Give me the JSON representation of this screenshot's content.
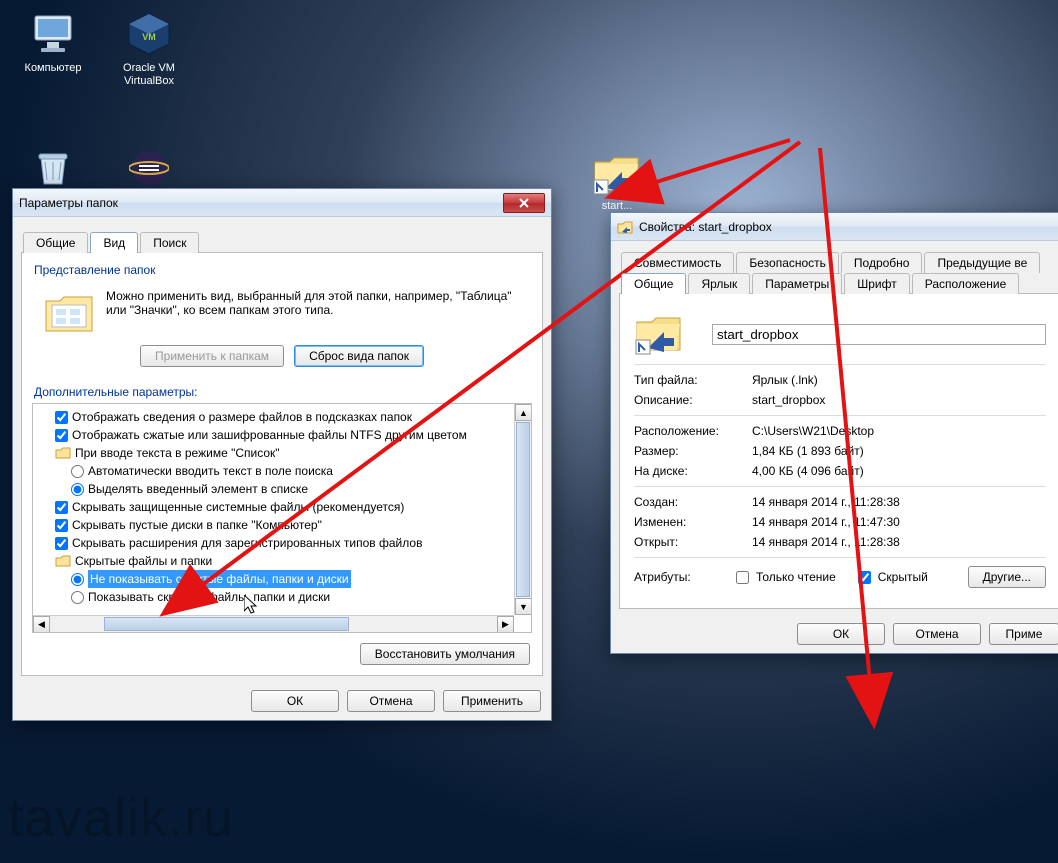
{
  "watermark": "tavalik.ru",
  "desktop": {
    "computer": "Компьютер",
    "virtualbox": "Oracle VM VirtualBox",
    "folder_shortcut_label": "start..."
  },
  "folderOptions": {
    "title": "Параметры папок",
    "tabs": {
      "general": "Общие",
      "view": "Вид",
      "search": "Поиск"
    },
    "group": "Представление папок",
    "desc": "Можно применить вид, выбранный для этой папки, например, \"Таблица\" или \"Значки\", ко всем папкам этого типа.",
    "applyBtn": "Применить к папкам",
    "resetBtn": "Сброс вида папок",
    "advLabel": "Дополнительные параметры:",
    "tree": {
      "size_hint": "Отображать сведения о размере файлов в подсказках папок",
      "ntfs_compressed": "Отображать сжатые или зашифрованные файлы NTFS другим цветом",
      "list_mode": "При вводе текста в режиме \"Список\"",
      "auto_type": "Автоматически вводить текст в поле поиска",
      "select_typed": "Выделять введенный элемент в списке",
      "protected": "Скрывать защищенные системные файлы (рекомендуется)",
      "empty_drives": "Скрывать пустые диски в папке \"Компьютер\"",
      "hide_ext": "Скрывать расширения для зарегистрированных типов файлов",
      "hidden_group": "Скрытые файлы и папки",
      "dont_show": "Не показывать скрытые файлы, папки и диски",
      "show": "Показывать скрытые файлы, папки и диски"
    },
    "restore": "Восстановить умолчания",
    "ok": "ОК",
    "cancel": "Отмена",
    "apply": "Применить"
  },
  "props": {
    "title": "Свойства: start_dropbox",
    "row1": {
      "compat": "Совместимость",
      "security": "Безопасность",
      "details": "Подробно",
      "prev": "Предыдущие ве"
    },
    "row2": {
      "general": "Общие",
      "shortcut": "Ярлык",
      "params": "Параметры",
      "font": "Шрифт",
      "layout": "Расположение"
    },
    "name": "start_dropbox",
    "type_lbl": "Тип файла:",
    "type_val": "Ярлык (.lnk)",
    "desc_lbl": "Описание:",
    "desc_val": "start_dropbox",
    "loc_lbl": "Расположение:",
    "loc_val": "C:\\Users\\W21\\Desktop",
    "size_lbl": "Размер:",
    "size_val": "1,84 КБ (1 893 байт)",
    "disk_lbl": "На диске:",
    "disk_val": "4,00 КБ (4 096 байт)",
    "created_lbl": "Создан:",
    "created_val": "14 января 2014 г., 11:28:38",
    "modified_lbl": "Изменен:",
    "modified_val": "14 января 2014 г., 11:47:30",
    "accessed_lbl": "Открыт:",
    "accessed_val": "14 января 2014 г., 11:28:38",
    "attr_lbl": "Атрибуты:",
    "readonly": "Только чтение",
    "hidden": "Скрытый",
    "other": "Другие...",
    "ok": "ОК",
    "cancel": "Отмена",
    "apply": "Приме"
  }
}
